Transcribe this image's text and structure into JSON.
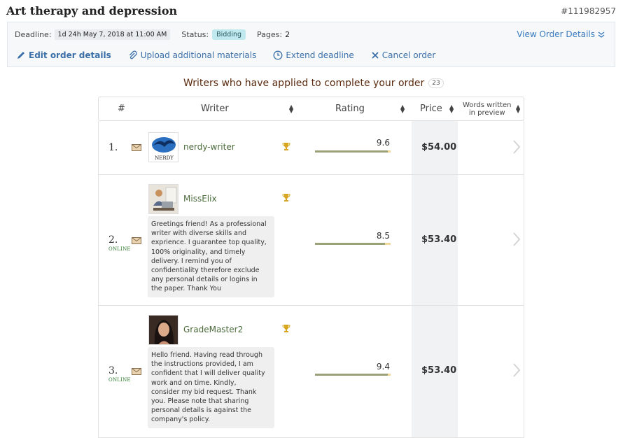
{
  "order": {
    "title": "Art therapy and depression",
    "id": "#111982957",
    "deadline_label": "Deadline:",
    "deadline_value": "1d 24h May 7, 2018 at 11:00 AM",
    "status_label": "Status:",
    "status_value": "Bidding",
    "pages_label": "Pages:",
    "pages_value": "2",
    "view_details": "View Order Details"
  },
  "actions": {
    "edit": "Edit order details",
    "upload": "Upload additional materials",
    "extend": "Extend deadline",
    "cancel": "Cancel order"
  },
  "applied": {
    "title": "Writers who have applied to complete your order",
    "count": "23"
  },
  "table": {
    "headers": {
      "num": "#",
      "writer": "Writer",
      "rating": "Rating",
      "price": "Price",
      "words_line1": "Words written",
      "words_line2": "in preview"
    },
    "rows": [
      {
        "num": "1.",
        "online": "",
        "writer": "nerdy-writer",
        "avatar_label": "NERDY",
        "message": "",
        "rating": "9.6",
        "rating_fraction": 0.96,
        "price": "$54.00"
      },
      {
        "num": "2.",
        "online": "ONLINE",
        "writer": "MissElix",
        "message_lines": [
          "Greetings friend! As a professional",
          "writer with diverse skills and",
          "exprience. I guarantee top quality,",
          "100% originality, and timely",
          "delivery. I remind you of",
          "confidentiality therefore exclude",
          "any personal details or logins in",
          "the paper. Thank You"
        ],
        "rating": "8.5",
        "rating_fraction": 0.93,
        "price": "$53.40"
      },
      {
        "num": "3.",
        "online": "ONLINE",
        "writer": "GradeMaster2",
        "message_lines": [
          "Hello friend. Having read through",
          "the instructions provided, I am",
          "confident that I will deliver quality",
          "work and on time. Kindly,",
          "consider my bid request. Thank",
          "you. Please note that sharing",
          "personal details is against the",
          "company's policy."
        ],
        "rating": "9.4",
        "rating_fraction": 0.96,
        "price": "$53.40"
      }
    ]
  },
  "colors": {
    "link": "#3a7bbf",
    "status_badge": "#bfe9ee",
    "online": "#2f7a2f",
    "rating_fill": "#9aa27a",
    "rating_track": "#f0d79a",
    "trophy": "#d8a520"
  }
}
